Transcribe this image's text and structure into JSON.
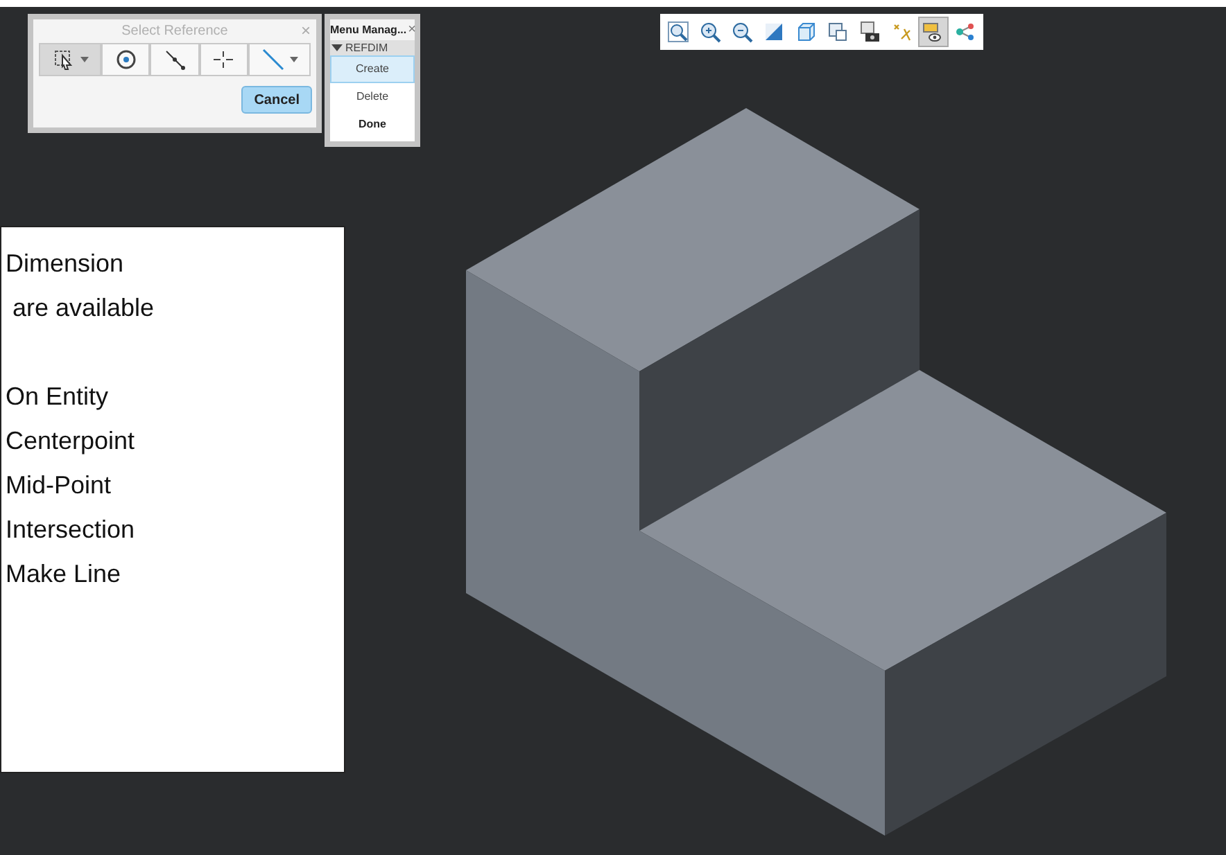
{
  "select_reference": {
    "title": "Select Reference",
    "close": "×",
    "cancel": "Cancel",
    "tools": [
      {
        "kind": "select",
        "selected": true
      },
      {
        "kind": "circle",
        "selected": false
      },
      {
        "kind": "segment",
        "selected": false
      },
      {
        "kind": "cross",
        "selected": false
      },
      {
        "kind": "line",
        "selected": false
      }
    ]
  },
  "menu_manager": {
    "title": "Menu Manag...",
    "close": "×",
    "section": "REFDIM",
    "items": [
      {
        "label": "Create",
        "selected": true,
        "bold": false
      },
      {
        "label": "Delete",
        "selected": false,
        "bold": false
      },
      {
        "label": "Done",
        "selected": false,
        "bold": true
      }
    ]
  },
  "toolbar": [
    {
      "kind": "zoom-fit",
      "selected": false
    },
    {
      "kind": "zoom-in",
      "selected": false
    },
    {
      "kind": "zoom-out",
      "selected": false
    },
    {
      "kind": "shade",
      "selected": false
    },
    {
      "kind": "cube",
      "selected": false
    },
    {
      "kind": "views",
      "selected": false
    },
    {
      "kind": "camera",
      "selected": false
    },
    {
      "kind": "datum",
      "selected": false
    },
    {
      "kind": "display",
      "selected": true
    },
    {
      "kind": "nodes",
      "selected": false
    }
  ],
  "note": {
    "heading": [
      "Dimension",
      " are available"
    ],
    "options": [
      "On Entity",
      "Centerpoint",
      "Mid-Point",
      "Intersection",
      "Make Line"
    ]
  }
}
